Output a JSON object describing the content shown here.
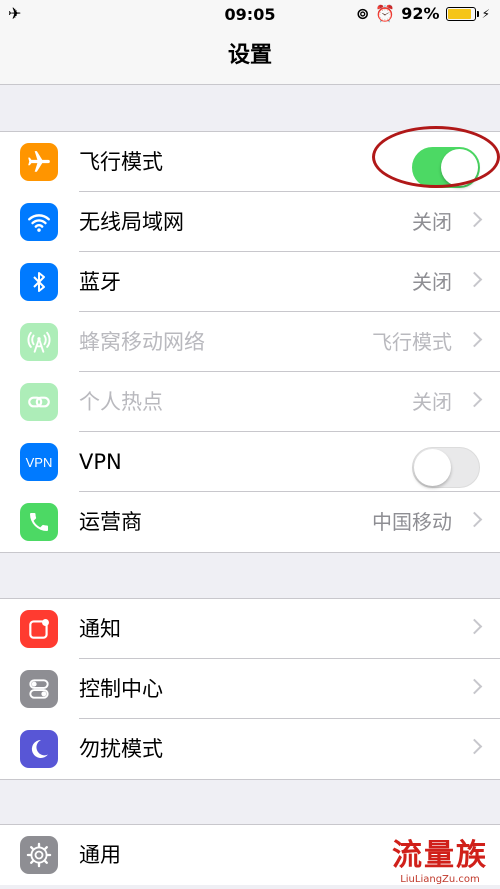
{
  "status_bar": {
    "time": "09:05",
    "battery": "92%"
  },
  "nav": {
    "title": "设置"
  },
  "group1": [
    {
      "label": "飞行模式",
      "toggle": "on",
      "icon": "airplane-icon",
      "color": "#ff9500"
    },
    {
      "label": "无线局域网",
      "value": "关闭",
      "icon": "wifi-icon",
      "color": "#007aff"
    },
    {
      "label": "蓝牙",
      "value": "关闭",
      "icon": "bluetooth-icon",
      "color": "#007aff"
    },
    {
      "label": "蜂窝移动网络",
      "value": "飞行模式",
      "icon": "cellular-icon",
      "color": "#4cd964",
      "disabled": true
    },
    {
      "label": "个人热点",
      "value": "关闭",
      "icon": "hotspot-icon",
      "color": "#4cd964",
      "disabled": true
    },
    {
      "label": "VPN",
      "toggle": "off",
      "icon": "vpn-icon",
      "icon_text": "VPN",
      "color": "#007aff"
    },
    {
      "label": "运营商",
      "value": "中国移动",
      "icon": "phone-icon",
      "color": "#4cd964"
    }
  ],
  "group2": [
    {
      "label": "通知",
      "icon": "notifications-icon",
      "color": "#ff3b30"
    },
    {
      "label": "控制中心",
      "icon": "control-center-icon",
      "color": "#8e8e93"
    },
    {
      "label": "勿扰模式",
      "icon": "moon-icon",
      "color": "#5856d6"
    }
  ],
  "group3": [
    {
      "label": "通用",
      "icon": "gear-icon",
      "color": "#8e8e93"
    }
  ],
  "watermark": {
    "text": "流量族",
    "url": "LiuLiangZu.com"
  }
}
